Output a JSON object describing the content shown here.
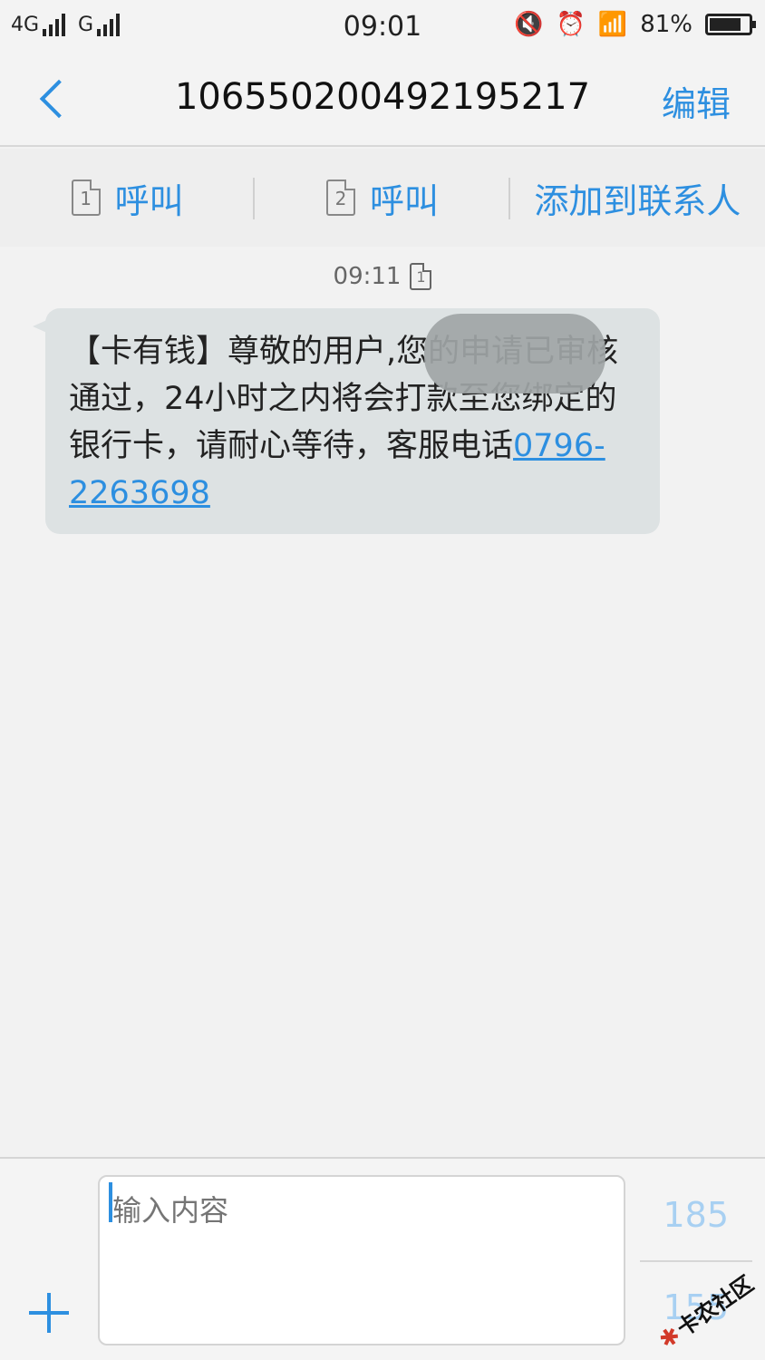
{
  "status_bar": {
    "network1": "4G",
    "network2": "G",
    "time": "09:01",
    "battery": "81%",
    "battery_level": 0.81
  },
  "header": {
    "title": "10655020049219521​7",
    "edit_label": "编辑"
  },
  "actions": {
    "call1_sim": "1",
    "call1_label": "呼叫",
    "call2_sim": "2",
    "call2_label": "呼叫",
    "add_contact_label": "添加到联系人"
  },
  "message": {
    "time": "09:11",
    "sim": "1",
    "text": "【卡有钱】尊敬的用户,您的申请已审核通过，24小时之内将会打款至您绑定的银行卡，请耐心等待，客服电话",
    "phone": "0796-2263698"
  },
  "composer": {
    "placeholder": "输入内容",
    "sim1_count": "185",
    "sim2_count": "155"
  },
  "watermark": "卡农社区",
  "colors": {
    "accent": "#2d8fe0",
    "bubble": "#dde2e3",
    "background": "#f2f2f2"
  }
}
